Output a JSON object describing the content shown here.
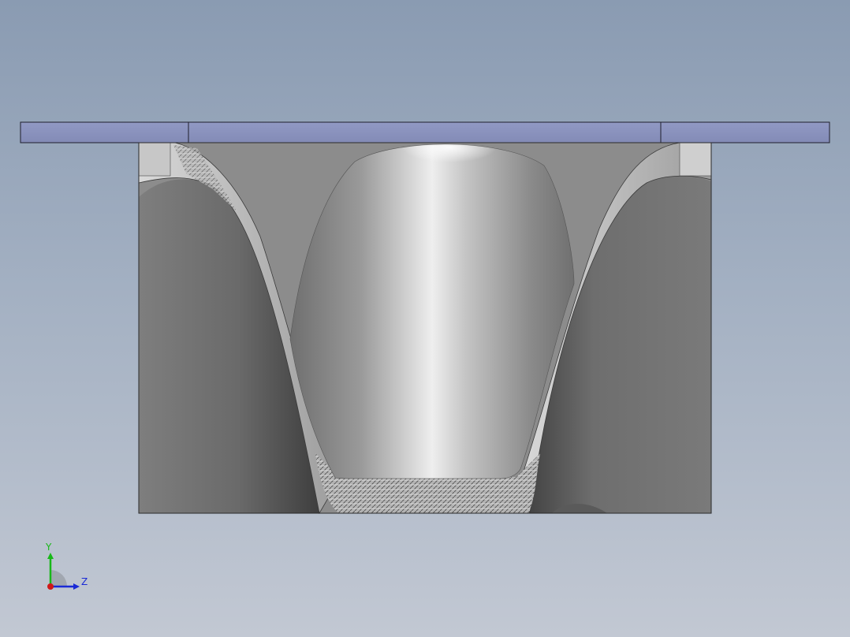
{
  "triad": {
    "y_label": "Y",
    "z_label": "Z",
    "y_color": "#18b818",
    "z_color": "#1a2ad6",
    "x_color": "#d01818"
  },
  "model": {
    "plate_color": "#8a93bd",
    "body_color": "#8c8c8c",
    "background_top": "#8a9bb2",
    "background_bottom": "#c2c8d3"
  }
}
